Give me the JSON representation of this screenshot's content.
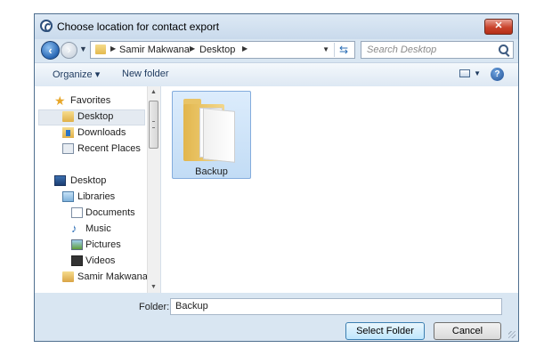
{
  "window": {
    "title": "Choose location for contact export",
    "close_label": "✕"
  },
  "address_bar": {
    "breadcrumbs": [
      "Samir Makwana",
      "Desktop"
    ],
    "search_placeholder": "Search Desktop"
  },
  "toolbar": {
    "organize_label": "Organize ▾",
    "new_folder_label": "New folder",
    "help_label": "?"
  },
  "nav_pane": {
    "favorites": {
      "label": "Favorites",
      "items": [
        "Desktop",
        "Downloads",
        "Recent Places"
      ]
    },
    "desktop_root": "Desktop",
    "libraries": {
      "label": "Libraries",
      "items": [
        "Documents",
        "Music",
        "Pictures",
        "Videos"
      ]
    },
    "user": "Samir Makwana",
    "selected": "Desktop"
  },
  "content": {
    "items": [
      {
        "name": "Backup",
        "type": "folder",
        "selected": true
      }
    ]
  },
  "footer": {
    "folder_label": "Folder:",
    "folder_value": "Backup",
    "select_label": "Select Folder",
    "cancel_label": "Cancel"
  },
  "colors": {
    "accent": "#3c7fb1",
    "frame": "#d9e6f2",
    "selection": "#c2dcf5"
  }
}
